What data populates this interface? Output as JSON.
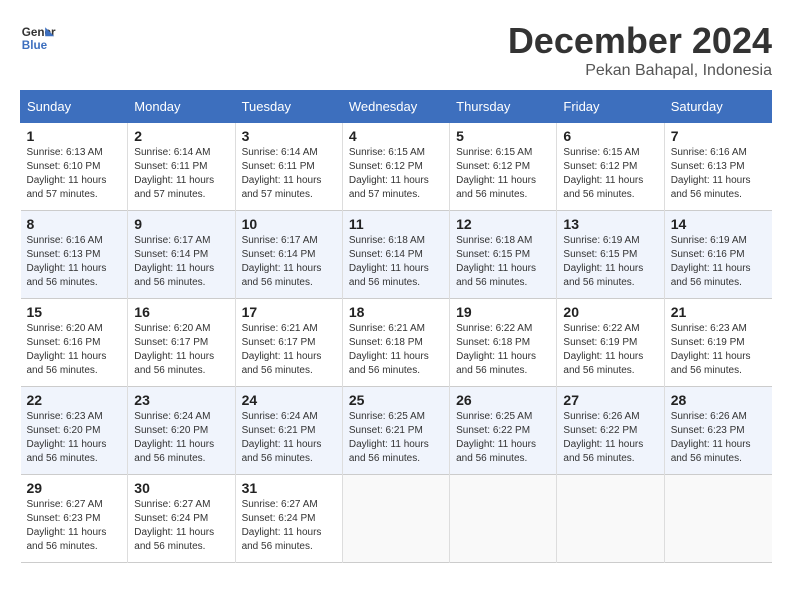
{
  "header": {
    "logo_line1": "General",
    "logo_line2": "Blue",
    "month_year": "December 2024",
    "location": "Pekan Bahapal, Indonesia"
  },
  "weekdays": [
    "Sunday",
    "Monday",
    "Tuesday",
    "Wednesday",
    "Thursday",
    "Friday",
    "Saturday"
  ],
  "weeks": [
    [
      {
        "day": "1",
        "info": "Sunrise: 6:13 AM\nSunset: 6:10 PM\nDaylight: 11 hours\nand 57 minutes."
      },
      {
        "day": "2",
        "info": "Sunrise: 6:14 AM\nSunset: 6:11 PM\nDaylight: 11 hours\nand 57 minutes."
      },
      {
        "day": "3",
        "info": "Sunrise: 6:14 AM\nSunset: 6:11 PM\nDaylight: 11 hours\nand 57 minutes."
      },
      {
        "day": "4",
        "info": "Sunrise: 6:15 AM\nSunset: 6:12 PM\nDaylight: 11 hours\nand 57 minutes."
      },
      {
        "day": "5",
        "info": "Sunrise: 6:15 AM\nSunset: 6:12 PM\nDaylight: 11 hours\nand 56 minutes."
      },
      {
        "day": "6",
        "info": "Sunrise: 6:15 AM\nSunset: 6:12 PM\nDaylight: 11 hours\nand 56 minutes."
      },
      {
        "day": "7",
        "info": "Sunrise: 6:16 AM\nSunset: 6:13 PM\nDaylight: 11 hours\nand 56 minutes."
      }
    ],
    [
      {
        "day": "8",
        "info": "Sunrise: 6:16 AM\nSunset: 6:13 PM\nDaylight: 11 hours\nand 56 minutes."
      },
      {
        "day": "9",
        "info": "Sunrise: 6:17 AM\nSunset: 6:14 PM\nDaylight: 11 hours\nand 56 minutes."
      },
      {
        "day": "10",
        "info": "Sunrise: 6:17 AM\nSunset: 6:14 PM\nDaylight: 11 hours\nand 56 minutes."
      },
      {
        "day": "11",
        "info": "Sunrise: 6:18 AM\nSunset: 6:14 PM\nDaylight: 11 hours\nand 56 minutes."
      },
      {
        "day": "12",
        "info": "Sunrise: 6:18 AM\nSunset: 6:15 PM\nDaylight: 11 hours\nand 56 minutes."
      },
      {
        "day": "13",
        "info": "Sunrise: 6:19 AM\nSunset: 6:15 PM\nDaylight: 11 hours\nand 56 minutes."
      },
      {
        "day": "14",
        "info": "Sunrise: 6:19 AM\nSunset: 6:16 PM\nDaylight: 11 hours\nand 56 minutes."
      }
    ],
    [
      {
        "day": "15",
        "info": "Sunrise: 6:20 AM\nSunset: 6:16 PM\nDaylight: 11 hours\nand 56 minutes."
      },
      {
        "day": "16",
        "info": "Sunrise: 6:20 AM\nSunset: 6:17 PM\nDaylight: 11 hours\nand 56 minutes."
      },
      {
        "day": "17",
        "info": "Sunrise: 6:21 AM\nSunset: 6:17 PM\nDaylight: 11 hours\nand 56 minutes."
      },
      {
        "day": "18",
        "info": "Sunrise: 6:21 AM\nSunset: 6:18 PM\nDaylight: 11 hours\nand 56 minutes."
      },
      {
        "day": "19",
        "info": "Sunrise: 6:22 AM\nSunset: 6:18 PM\nDaylight: 11 hours\nand 56 minutes."
      },
      {
        "day": "20",
        "info": "Sunrise: 6:22 AM\nSunset: 6:19 PM\nDaylight: 11 hours\nand 56 minutes."
      },
      {
        "day": "21",
        "info": "Sunrise: 6:23 AM\nSunset: 6:19 PM\nDaylight: 11 hours\nand 56 minutes."
      }
    ],
    [
      {
        "day": "22",
        "info": "Sunrise: 6:23 AM\nSunset: 6:20 PM\nDaylight: 11 hours\nand 56 minutes."
      },
      {
        "day": "23",
        "info": "Sunrise: 6:24 AM\nSunset: 6:20 PM\nDaylight: 11 hours\nand 56 minutes."
      },
      {
        "day": "24",
        "info": "Sunrise: 6:24 AM\nSunset: 6:21 PM\nDaylight: 11 hours\nand 56 minutes."
      },
      {
        "day": "25",
        "info": "Sunrise: 6:25 AM\nSunset: 6:21 PM\nDaylight: 11 hours\nand 56 minutes."
      },
      {
        "day": "26",
        "info": "Sunrise: 6:25 AM\nSunset: 6:22 PM\nDaylight: 11 hours\nand 56 minutes."
      },
      {
        "day": "27",
        "info": "Sunrise: 6:26 AM\nSunset: 6:22 PM\nDaylight: 11 hours\nand 56 minutes."
      },
      {
        "day": "28",
        "info": "Sunrise: 6:26 AM\nSunset: 6:23 PM\nDaylight: 11 hours\nand 56 minutes."
      }
    ],
    [
      {
        "day": "29",
        "info": "Sunrise: 6:27 AM\nSunset: 6:23 PM\nDaylight: 11 hours\nand 56 minutes."
      },
      {
        "day": "30",
        "info": "Sunrise: 6:27 AM\nSunset: 6:24 PM\nDaylight: 11 hours\nand 56 minutes."
      },
      {
        "day": "31",
        "info": "Sunrise: 6:27 AM\nSunset: 6:24 PM\nDaylight: 11 hours\nand 56 minutes."
      },
      {
        "day": "",
        "info": ""
      },
      {
        "day": "",
        "info": ""
      },
      {
        "day": "",
        "info": ""
      },
      {
        "day": "",
        "info": ""
      }
    ]
  ]
}
